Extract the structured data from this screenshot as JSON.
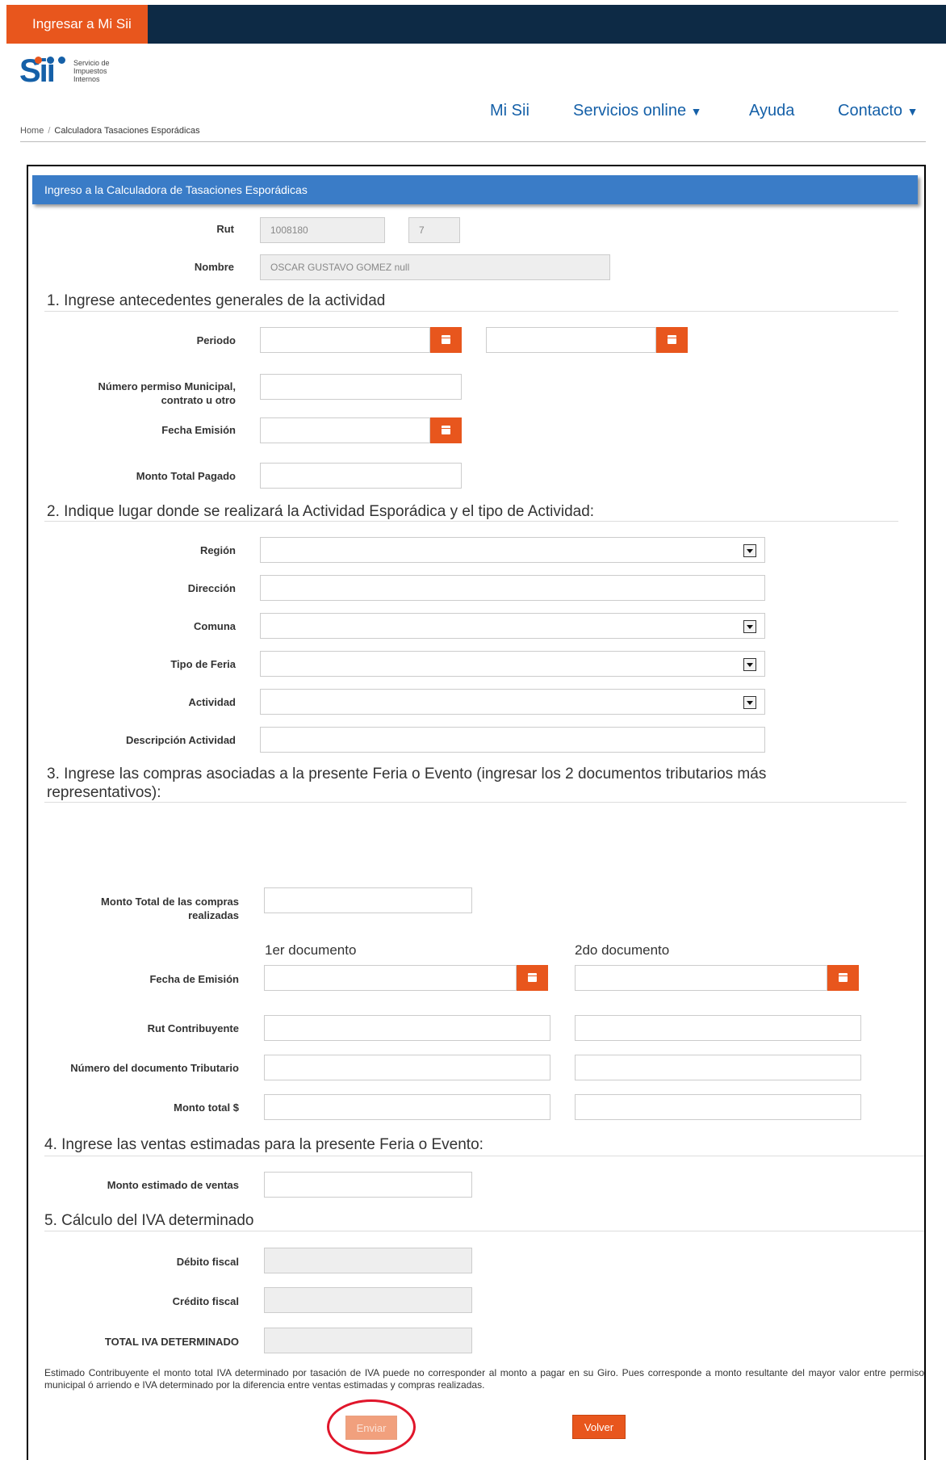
{
  "topbar": {
    "login_label": "Ingresar a Mi Sii"
  },
  "logo": {
    "name": "Sii",
    "line1": "Servicio de",
    "line2": "Impuestos",
    "line3": "Internos"
  },
  "nav": {
    "mi_sii": "Mi Sii",
    "servicios": "Servicios online",
    "ayuda": "Ayuda",
    "contacto": "Contacto"
  },
  "breadcrumb": {
    "home": "Home",
    "separator": "/",
    "current": "Calculadora Tasaciones Esporádicas"
  },
  "panel": {
    "title": "Ingreso a la Calculadora de Tasaciones Esporádicas"
  },
  "identity": {
    "rut_label": "Rut",
    "rut_value": "1008180",
    "dv_value": "7",
    "nombre_label": "Nombre",
    "nombre_value": "OSCAR GUSTAVO GOMEZ null"
  },
  "section1": {
    "title": "1. Ingrese antecedentes generales de la actividad",
    "periodo_label": "Periodo",
    "permiso_label_1": "Número permiso Municipal,",
    "permiso_label_2": "contrato u otro",
    "fecha_emision_label": "Fecha Emisión",
    "monto_pagado_label": "Monto Total Pagado"
  },
  "section2": {
    "title": "2. Indique lugar donde se realizará la Actividad Esporádica y el tipo de Actividad:",
    "region_label": "Región",
    "direccion_label": "Dirección",
    "comuna_label": "Comuna",
    "tipo_feria_label": "Tipo de Feria",
    "actividad_label": "Actividad",
    "descripcion_label": "Descripción Actividad"
  },
  "section3": {
    "title_1": "3. Ingrese las compras asociadas a la presente Feria o Evento (ingresar los 2 documentos tributarios más",
    "title_2": "representativos):",
    "monto_compras_label_1": "Monto Total de las compras",
    "monto_compras_label_2": "realizadas",
    "doc1_header": "1er documento",
    "doc2_header": "2do documento",
    "fecha_emision_label": "Fecha de Emisión",
    "rut_contribuyente_label": "Rut Contribuyente",
    "numero_documento_label": "Número del documento Tributario",
    "monto_total_label": "Monto total $"
  },
  "section4": {
    "title": "4. Ingrese las ventas estimadas para la presente Feria o Evento:",
    "monto_ventas_label": "Monto estimado de ventas"
  },
  "section5": {
    "title": "5. Cálculo del IVA determinado",
    "debito_label": "Débito fiscal",
    "credito_label": "Crédito fiscal",
    "total_label": "TOTAL IVA DETERMINADO"
  },
  "note": "Estimado Contribuyente el monto total IVA determinado por tasación de IVA puede no corresponder al monto a pagar en su Giro. Pues corresponde a monto resultante del mayor valor entre permiso municipal ó arriendo e IVA determinado por la diferencia entre ventas estimadas y compras realizadas.",
  "buttons": {
    "enviar": "Enviar",
    "volver": "Volver"
  },
  "colors": {
    "accent": "#e8561d",
    "topbar": "#0d2a45",
    "panel": "#3a7cc7",
    "link": "#1560a8",
    "highlight": "#e0162b"
  }
}
